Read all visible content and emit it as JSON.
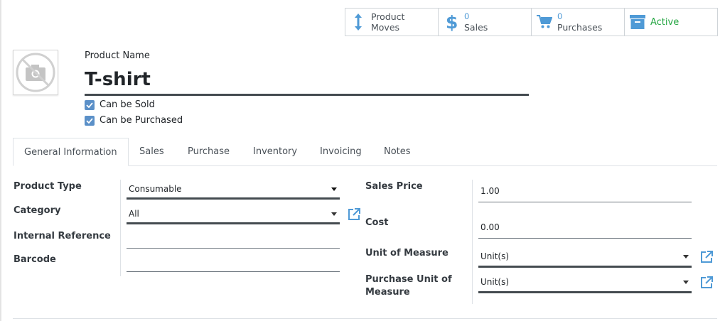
{
  "smart_buttons": [
    {
      "icon": "arrows-updown-icon",
      "line1": "Product",
      "line2": "Moves"
    },
    {
      "icon": "dollar-icon",
      "count": "0",
      "label": "Sales"
    },
    {
      "icon": "cart-icon",
      "count": "0",
      "label": "Purchases"
    },
    {
      "icon": "archive-icon",
      "label": "Active"
    }
  ],
  "product": {
    "name_label": "Product Name",
    "name_value": "T-shirt",
    "can_be_sold": "Can be Sold",
    "can_be_purchased": "Can be Purchased"
  },
  "tabs": [
    "General Information",
    "Sales",
    "Purchase",
    "Inventory",
    "Invoicing",
    "Notes"
  ],
  "left_fields": {
    "product_type_label": "Product Type",
    "product_type_value": "Consumable",
    "category_label": "Category",
    "category_value": "All",
    "internal_ref_label": "Internal Reference",
    "internal_ref_value": "",
    "barcode_label": "Barcode",
    "barcode_value": ""
  },
  "right_fields": {
    "sales_price_label": "Sales Price",
    "sales_price_value": "1.00",
    "cost_label": "Cost",
    "cost_value": "0.00",
    "uom_label": "Unit of Measure",
    "uom_value": "Unit(s)",
    "purchase_uom_label_1": "Purchase Unit of",
    "purchase_uom_label_2": "Measure",
    "purchase_uom_value": "Unit(s)"
  },
  "colors": {
    "accent": "#5b90c8",
    "active_green": "#28a745",
    "icon_blue": "#4f9ad6"
  }
}
